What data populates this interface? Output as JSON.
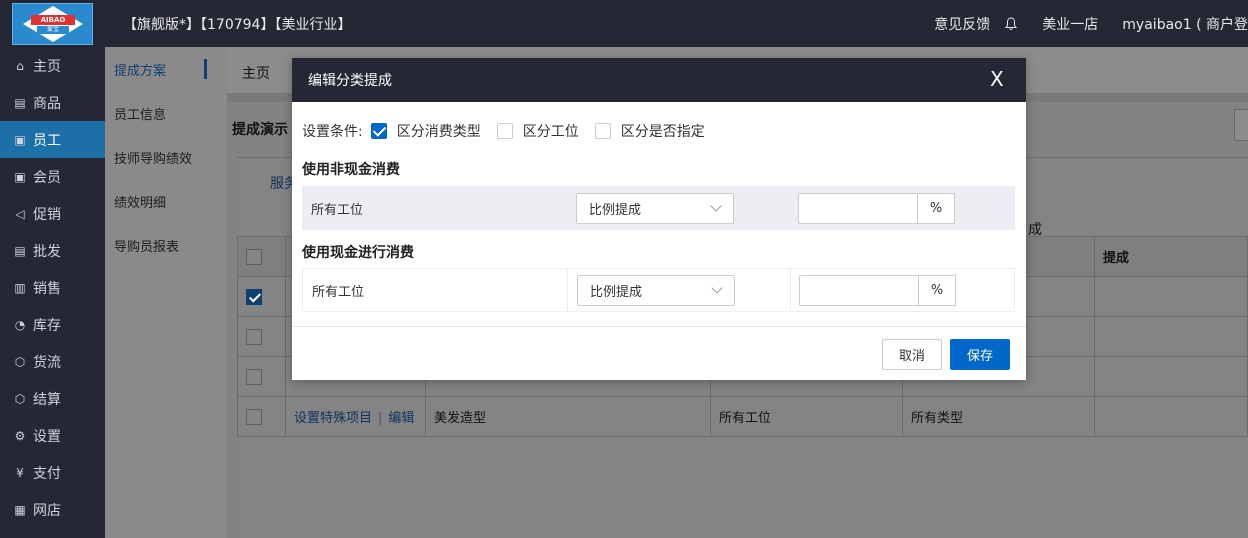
{
  "topbar": {
    "logo_text": "AIBAO",
    "logo_sub": "爱宝",
    "title": "【旗舰版*】【170794】【美业行业】",
    "feedback": "意见反馈",
    "store": "美业一店",
    "user": "myaibao1 ( 商户登"
  },
  "leftnav": {
    "items": [
      {
        "label": "主页",
        "icon": "home-icon"
      },
      {
        "label": "商品",
        "icon": "box-icon"
      },
      {
        "label": "员工",
        "icon": "id-card-icon"
      },
      {
        "label": "会员",
        "icon": "member-icon"
      },
      {
        "label": "促销",
        "icon": "megaphone-icon"
      },
      {
        "label": "批发",
        "icon": "list-icon"
      },
      {
        "label": "销售",
        "icon": "chart-icon"
      },
      {
        "label": "库存",
        "icon": "pie-icon"
      },
      {
        "label": "货流",
        "icon": "cube-icon"
      },
      {
        "label": "结算",
        "icon": "cube-icon"
      },
      {
        "label": "设置",
        "icon": "gear-icon"
      },
      {
        "label": "支付",
        "icon": "yen-icon"
      },
      {
        "label": "网店",
        "icon": "gift-icon"
      }
    ],
    "active_index": 2
  },
  "subnav": {
    "items": [
      "提成方案",
      "员工信息",
      "技师导购绩效",
      "绩效明细",
      "导购员报表"
    ],
    "active_index": 0
  },
  "main": {
    "home_tab": "主页",
    "panel_title": "提成演示",
    "inner_tab": "服务",
    "ext_label": "成",
    "table": {
      "header_last": "提成",
      "last_row": {
        "link_special": "设置特殊项目",
        "link_edit": "编辑",
        "project": "美发造型",
        "station": "所有工位",
        "type": "所有类型"
      }
    }
  },
  "modal": {
    "title": "编辑分类提成",
    "close": "X",
    "condition_label": "设置条件:",
    "conditions": [
      {
        "label": "区分消费类型",
        "checked": true
      },
      {
        "label": "区分工位",
        "checked": false
      },
      {
        "label": "区分是否指定",
        "checked": false
      }
    ],
    "section1": {
      "title": "使用非现金消费",
      "station": "所有工位",
      "method": "比例提成",
      "value": "",
      "unit": "%"
    },
    "section2": {
      "title": "使用现金进行消费",
      "station": "所有工位",
      "method": "比例提成",
      "value": "",
      "unit": "%"
    },
    "cancel": "取消",
    "save": "保存"
  }
}
